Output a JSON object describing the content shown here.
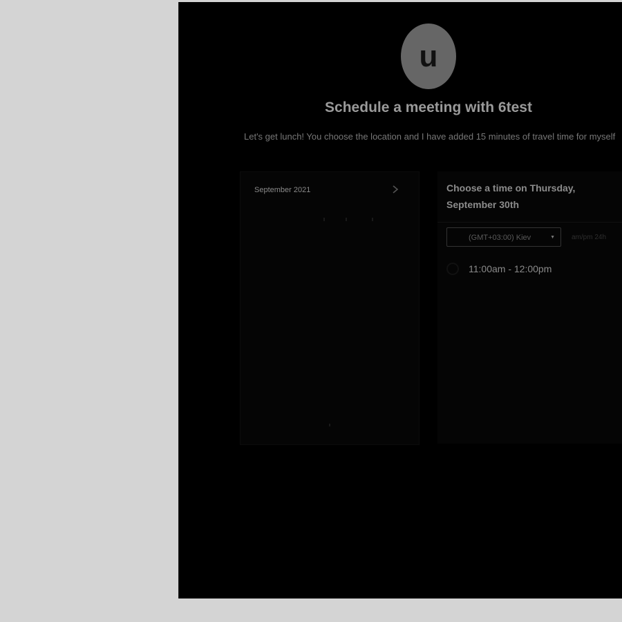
{
  "host": {
    "avatar_initial": "u"
  },
  "header": {
    "title": "Schedule a meeting with 6test",
    "description": "Let's get lunch! You choose the location and I have added 15 minutes of travel time for myself"
  },
  "calendar": {
    "month_label": "September 2021",
    "next_icon": "chevron-right-icon"
  },
  "times": {
    "heading": "Choose a time on Thursday, September 30th",
    "timezone": "(GMT+03:00) Kiev",
    "format_toggle": "am/pm  24h",
    "slots": [
      {
        "label": "11:00am - 12:00pm"
      }
    ]
  },
  "colors": {
    "page_bg": "#d4d4d4",
    "panel_bg": "#000000",
    "avatar_bg": "#666666"
  }
}
